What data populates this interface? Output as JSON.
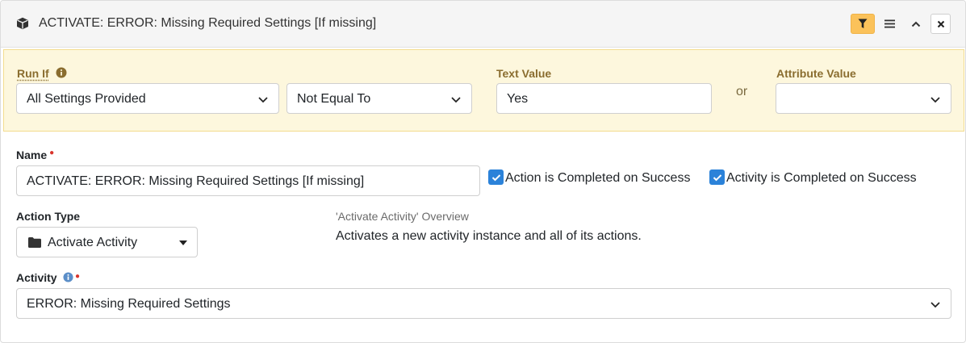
{
  "header": {
    "title": "ACTIVATE: ERROR: Missing Required Settings [If missing]",
    "icons": [
      "cube-icon",
      "filter-icon",
      "menu-icon",
      "chevron-up-icon",
      "close-icon"
    ]
  },
  "run_if": {
    "label": "Run If",
    "attribute_selected": "All Settings Provided",
    "comparison_selected": "Not Equal To",
    "text_value_label": "Text Value",
    "text_value": "Yes",
    "or_label": "or",
    "attribute_value_label": "Attribute Value",
    "attribute_value_selected": ""
  },
  "name": {
    "label": "Name",
    "value": "ACTIVATE: ERROR: Missing Required Settings [If missing]"
  },
  "options": {
    "action_completed_label": "Action is Completed on Success",
    "action_completed_checked": true,
    "activity_completed_label": "Activity is Completed on Success",
    "activity_completed_checked": true
  },
  "action_type": {
    "label": "Action Type",
    "selected": "Activate Activity"
  },
  "overview": {
    "title": "'Activate Activity' Overview",
    "description": "Activates a new activity instance and all of its actions."
  },
  "activity": {
    "label": "Activity",
    "selected": "ERROR: Missing Required Settings"
  },
  "colors": {
    "accent_filter": "#fbc25a",
    "checkbox": "#2b82d9",
    "runif_bg": "#fdf7dd",
    "required": "#d9342b"
  }
}
